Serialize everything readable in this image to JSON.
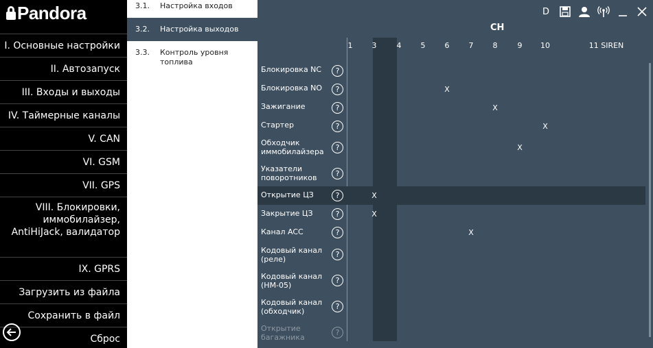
{
  "logo": {
    "text": "Pandora"
  },
  "menu": [
    "I. Основные настройки",
    "II. Автозапуск",
    "III. Входы и выходы",
    "IV. Таймерные каналы",
    "V. CAN",
    "VI. GSM",
    "VII. GPS",
    "VIII. Блокировки, иммобилайзер, AntiHiJack, валидатор",
    "IX. GPRS",
    "Загрузить из файла",
    "Сохранить в файл",
    "Сброс"
  ],
  "submenu": [
    {
      "num": "3.1.",
      "label": "Настройка входов",
      "active": false
    },
    {
      "num": "3.2.",
      "label": "Настройка выходов",
      "active": true
    },
    {
      "num": "3.3.",
      "label": "Контроль уровня топлива",
      "active": false
    }
  ],
  "topbar": {
    "d_label": "D"
  },
  "grid": {
    "title": "CH",
    "columns": [
      "1",
      "3",
      "4",
      "5",
      "6",
      "7",
      "8",
      "9",
      "10",
      "11 SIREN"
    ],
    "help_symbol": "?",
    "mark_symbol": "X",
    "rows": [
      {
        "label": "Блокировка NC",
        "marks": []
      },
      {
        "label": "Блокировка NO",
        "marks": [
          "6"
        ]
      },
      {
        "label": "Зажигание",
        "marks": [
          "8"
        ]
      },
      {
        "label": "Стартер",
        "marks": [
          "10"
        ]
      },
      {
        "label": "Обходчик иммобилайзера",
        "marks": [
          "9"
        ]
      },
      {
        "label": "Указатели поворотников",
        "marks": []
      },
      {
        "label": "Открытие ЦЗ",
        "marks": [
          "3"
        ],
        "highlight": true
      },
      {
        "label": "Закрытие ЦЗ",
        "marks": [
          "3"
        ]
      },
      {
        "label": "Канал ACC",
        "marks": [
          "7"
        ]
      },
      {
        "label": "Кодовый канал (реле)",
        "marks": []
      },
      {
        "label": "Кодовый канал (HM-05)",
        "marks": []
      },
      {
        "label": "Кодовый канал (обходчик)",
        "marks": []
      },
      {
        "label": "Открытие багажника",
        "marks": [],
        "faded": true
      }
    ]
  }
}
